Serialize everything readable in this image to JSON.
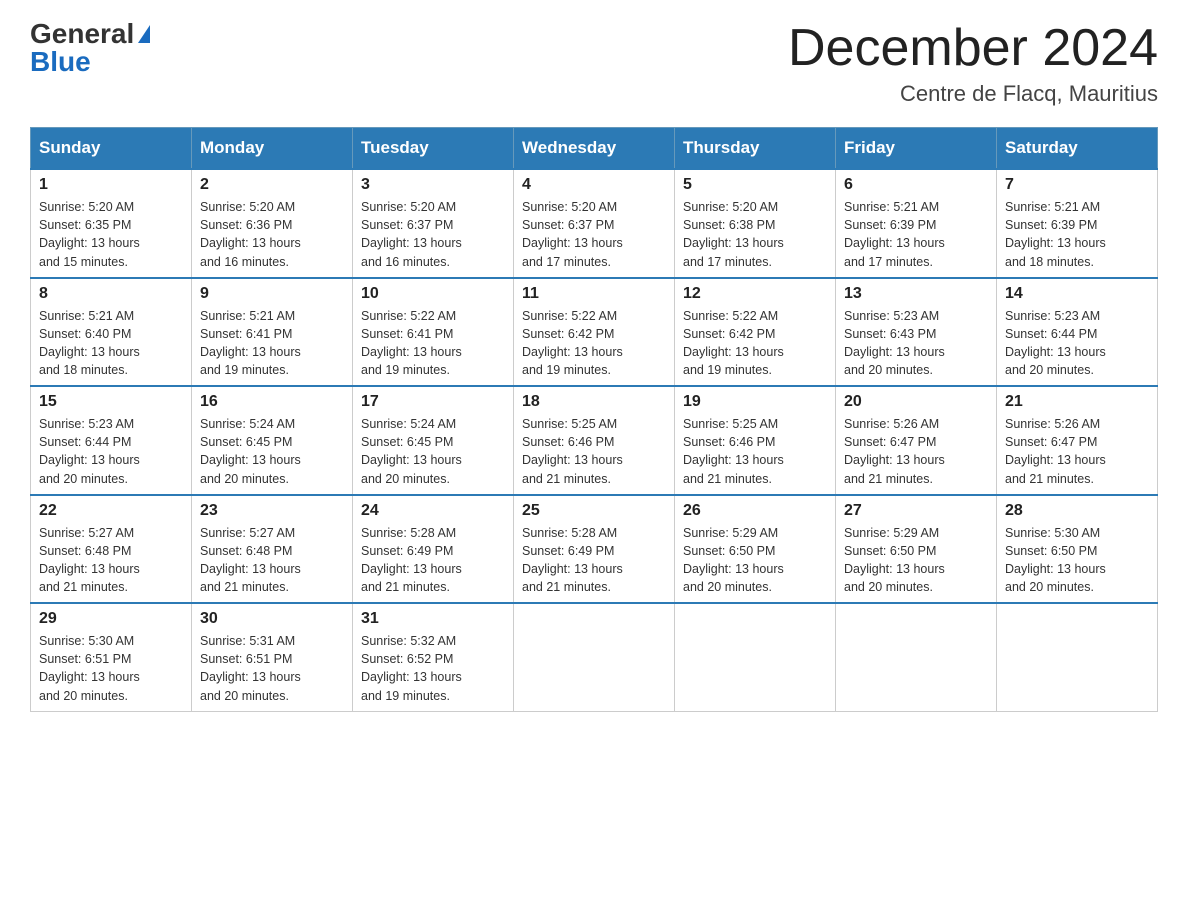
{
  "logo": {
    "general": "General",
    "blue": "Blue"
  },
  "header": {
    "title": "December 2024",
    "subtitle": "Centre de Flacq, Mauritius"
  },
  "days_of_week": [
    "Sunday",
    "Monday",
    "Tuesday",
    "Wednesday",
    "Thursday",
    "Friday",
    "Saturday"
  ],
  "weeks": [
    [
      {
        "day": "1",
        "sunrise": "5:20 AM",
        "sunset": "6:35 PM",
        "daylight": "13 hours and 15 minutes."
      },
      {
        "day": "2",
        "sunrise": "5:20 AM",
        "sunset": "6:36 PM",
        "daylight": "13 hours and 16 minutes."
      },
      {
        "day": "3",
        "sunrise": "5:20 AM",
        "sunset": "6:37 PM",
        "daylight": "13 hours and 16 minutes."
      },
      {
        "day": "4",
        "sunrise": "5:20 AM",
        "sunset": "6:37 PM",
        "daylight": "13 hours and 17 minutes."
      },
      {
        "day": "5",
        "sunrise": "5:20 AM",
        "sunset": "6:38 PM",
        "daylight": "13 hours and 17 minutes."
      },
      {
        "day": "6",
        "sunrise": "5:21 AM",
        "sunset": "6:39 PM",
        "daylight": "13 hours and 17 minutes."
      },
      {
        "day": "7",
        "sunrise": "5:21 AM",
        "sunset": "6:39 PM",
        "daylight": "13 hours and 18 minutes."
      }
    ],
    [
      {
        "day": "8",
        "sunrise": "5:21 AM",
        "sunset": "6:40 PM",
        "daylight": "13 hours and 18 minutes."
      },
      {
        "day": "9",
        "sunrise": "5:21 AM",
        "sunset": "6:41 PM",
        "daylight": "13 hours and 19 minutes."
      },
      {
        "day": "10",
        "sunrise": "5:22 AM",
        "sunset": "6:41 PM",
        "daylight": "13 hours and 19 minutes."
      },
      {
        "day": "11",
        "sunrise": "5:22 AM",
        "sunset": "6:42 PM",
        "daylight": "13 hours and 19 minutes."
      },
      {
        "day": "12",
        "sunrise": "5:22 AM",
        "sunset": "6:42 PM",
        "daylight": "13 hours and 19 minutes."
      },
      {
        "day": "13",
        "sunrise": "5:23 AM",
        "sunset": "6:43 PM",
        "daylight": "13 hours and 20 minutes."
      },
      {
        "day": "14",
        "sunrise": "5:23 AM",
        "sunset": "6:44 PM",
        "daylight": "13 hours and 20 minutes."
      }
    ],
    [
      {
        "day": "15",
        "sunrise": "5:23 AM",
        "sunset": "6:44 PM",
        "daylight": "13 hours and 20 minutes."
      },
      {
        "day": "16",
        "sunrise": "5:24 AM",
        "sunset": "6:45 PM",
        "daylight": "13 hours and 20 minutes."
      },
      {
        "day": "17",
        "sunrise": "5:24 AM",
        "sunset": "6:45 PM",
        "daylight": "13 hours and 20 minutes."
      },
      {
        "day": "18",
        "sunrise": "5:25 AM",
        "sunset": "6:46 PM",
        "daylight": "13 hours and 21 minutes."
      },
      {
        "day": "19",
        "sunrise": "5:25 AM",
        "sunset": "6:46 PM",
        "daylight": "13 hours and 21 minutes."
      },
      {
        "day": "20",
        "sunrise": "5:26 AM",
        "sunset": "6:47 PM",
        "daylight": "13 hours and 21 minutes."
      },
      {
        "day": "21",
        "sunrise": "5:26 AM",
        "sunset": "6:47 PM",
        "daylight": "13 hours and 21 minutes."
      }
    ],
    [
      {
        "day": "22",
        "sunrise": "5:27 AM",
        "sunset": "6:48 PM",
        "daylight": "13 hours and 21 minutes."
      },
      {
        "day": "23",
        "sunrise": "5:27 AM",
        "sunset": "6:48 PM",
        "daylight": "13 hours and 21 minutes."
      },
      {
        "day": "24",
        "sunrise": "5:28 AM",
        "sunset": "6:49 PM",
        "daylight": "13 hours and 21 minutes."
      },
      {
        "day": "25",
        "sunrise": "5:28 AM",
        "sunset": "6:49 PM",
        "daylight": "13 hours and 21 minutes."
      },
      {
        "day": "26",
        "sunrise": "5:29 AM",
        "sunset": "6:50 PM",
        "daylight": "13 hours and 20 minutes."
      },
      {
        "day": "27",
        "sunrise": "5:29 AM",
        "sunset": "6:50 PM",
        "daylight": "13 hours and 20 minutes."
      },
      {
        "day": "28",
        "sunrise": "5:30 AM",
        "sunset": "6:50 PM",
        "daylight": "13 hours and 20 minutes."
      }
    ],
    [
      {
        "day": "29",
        "sunrise": "5:30 AM",
        "sunset": "6:51 PM",
        "daylight": "13 hours and 20 minutes."
      },
      {
        "day": "30",
        "sunrise": "5:31 AM",
        "sunset": "6:51 PM",
        "daylight": "13 hours and 20 minutes."
      },
      {
        "day": "31",
        "sunrise": "5:32 AM",
        "sunset": "6:52 PM",
        "daylight": "13 hours and 19 minutes."
      },
      null,
      null,
      null,
      null
    ]
  ],
  "labels": {
    "sunrise": "Sunrise:",
    "sunset": "Sunset:",
    "daylight": "Daylight:"
  }
}
